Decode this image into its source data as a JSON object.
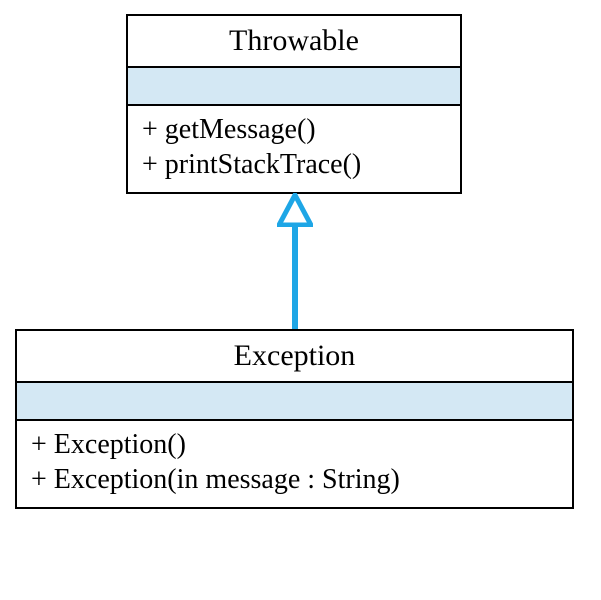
{
  "classes": {
    "throwable": {
      "name": "Throwable",
      "methods": [
        "+  getMessage()",
        "+  printStackTrace()"
      ]
    },
    "exception": {
      "name": "Exception",
      "methods": [
        "+  Exception()",
        "+  Exception(in message : String)"
      ]
    }
  }
}
